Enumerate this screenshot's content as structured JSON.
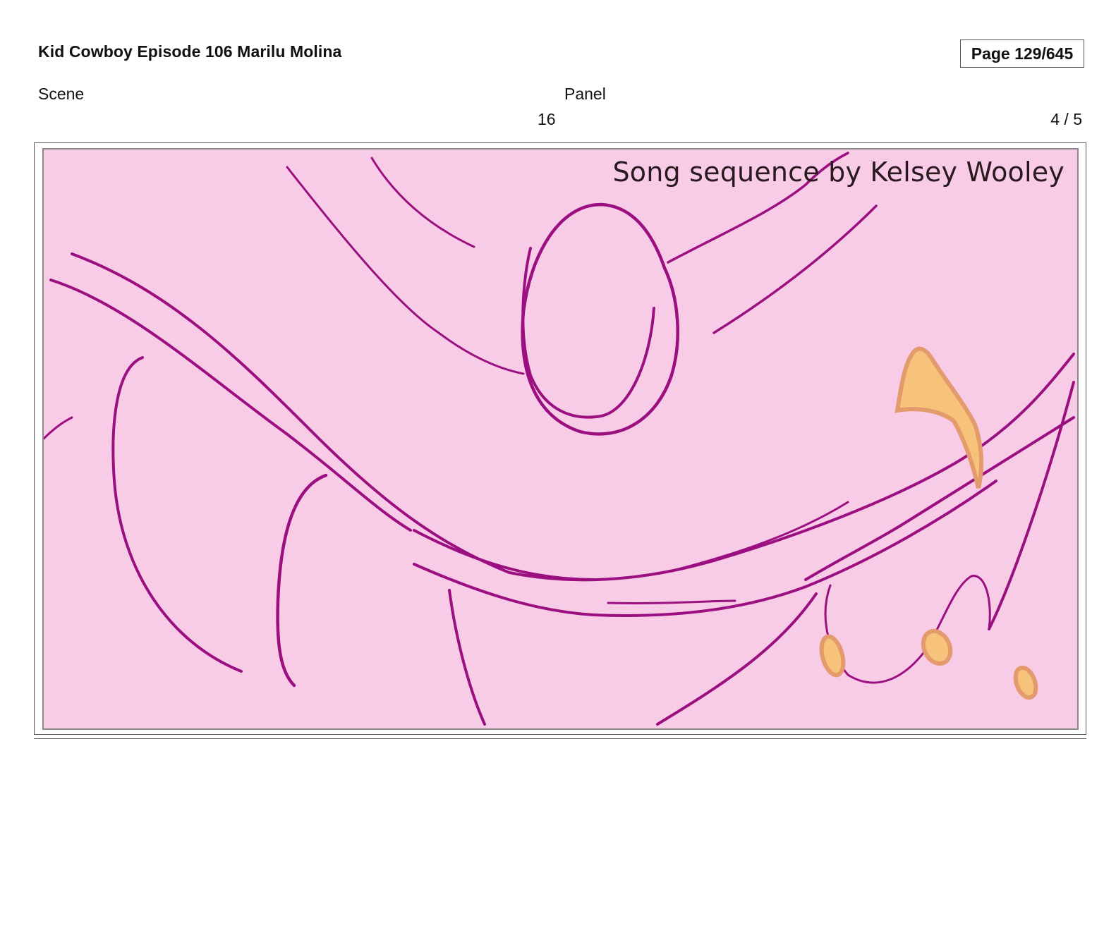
{
  "header": {
    "title": "Kid Cowboy Episode 106 Marilu Molina",
    "page_label": "Page 129/645"
  },
  "fields": {
    "scene_label": "Scene",
    "scene_value": "16",
    "panel_label": "Panel",
    "panel_value": "4 / 5"
  },
  "panel": {
    "caption": "Song sequence by Kelsey Wooley",
    "background_color": "#f8cce6",
    "line_color": "#9b0f80",
    "accent_color": "#f7c27a",
    "accent_shadow_color": "#e39a6c"
  }
}
